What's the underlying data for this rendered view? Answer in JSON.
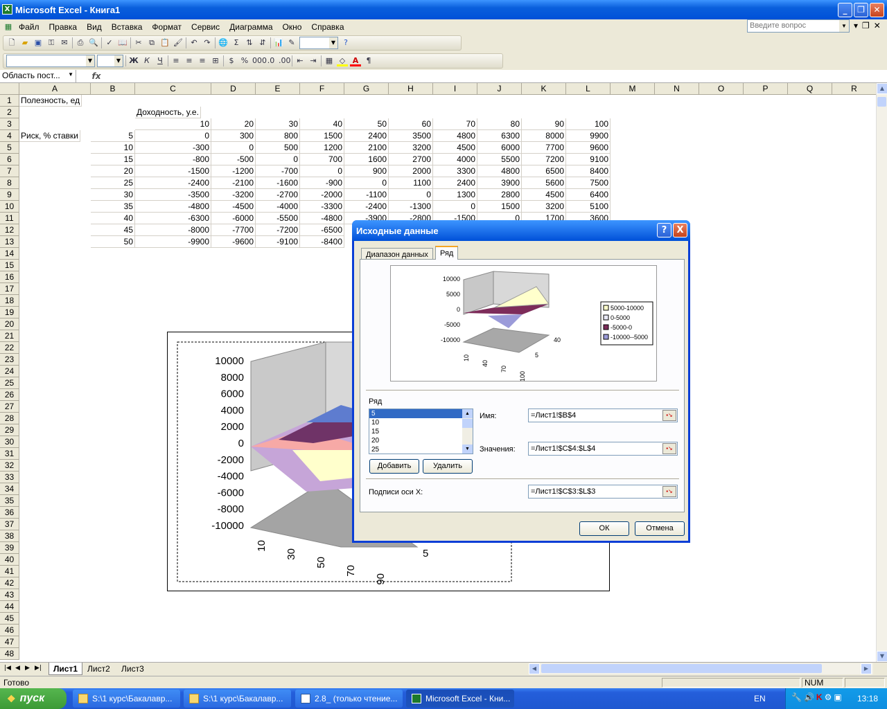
{
  "window": {
    "title": "Microsoft Excel - Книга1",
    "app_icon": "X"
  },
  "menu": [
    "Файл",
    "Правка",
    "Вид",
    "Вставка",
    "Формат",
    "Сервис",
    "Диаграмма",
    "Окно",
    "Справка"
  ],
  "help_box": {
    "placeholder": "Введите вопрос"
  },
  "formula_bar": {
    "name_box": "Область пост...",
    "fx": "fx",
    "formula": ""
  },
  "columns": [
    "A",
    "B",
    "C",
    "D",
    "E",
    "F",
    "G",
    "H",
    "I",
    "J",
    "K",
    "L",
    "M",
    "N",
    "O",
    "P",
    "Q",
    "R"
  ],
  "rows": [
    "1",
    "2",
    "3",
    "4",
    "5",
    "6",
    "7",
    "8",
    "9",
    "10",
    "11",
    "12",
    "13",
    "14",
    "15",
    "16",
    "17",
    "18",
    "19",
    "20",
    "21",
    "22",
    "23",
    "24",
    "25",
    "26",
    "27",
    "28",
    "29",
    "30",
    "31",
    "32",
    "33",
    "34",
    "35",
    "36",
    "37",
    "38",
    "39",
    "40",
    "41",
    "42",
    "43",
    "44",
    "45",
    "46",
    "47",
    "48"
  ],
  "cells": {
    "a1": "Полезность, ед",
    "c2": "Доходность, у.е.",
    "a4": "Риск, % ставки",
    "header_row": [
      "10",
      "20",
      "30",
      "40",
      "50",
      "60",
      "70",
      "80",
      "90",
      "100"
    ],
    "b_values": [
      "5",
      "10",
      "15",
      "20",
      "25",
      "30",
      "35",
      "40",
      "45",
      "50"
    ],
    "r4": [
      "0",
      "300",
      "800",
      "1500",
      "2400",
      "3500",
      "4800",
      "6300",
      "8000",
      "9900"
    ],
    "r5": [
      "-300",
      "0",
      "500",
      "1200",
      "2100",
      "3200",
      "4500",
      "6000",
      "7700",
      "9600"
    ],
    "r6": [
      "-800",
      "-500",
      "0",
      "700",
      "1600",
      "2700",
      "4000",
      "5500",
      "7200",
      "9100"
    ],
    "r7": [
      "-1500",
      "-1200",
      "-700",
      "0",
      "900",
      "2000",
      "3300",
      "4800",
      "6500",
      "8400"
    ],
    "r8": [
      "-2400",
      "-2100",
      "-1600",
      "-900",
      "0",
      "1100",
      "2400",
      "3900",
      "5600",
      "7500"
    ],
    "r9": [
      "-3500",
      "-3200",
      "-2700",
      "-2000",
      "-1100",
      "0",
      "1300",
      "2800",
      "4500",
      "6400"
    ],
    "r10": [
      "-4800",
      "-4500",
      "-4000",
      "-3300",
      "-2400",
      "-1300",
      "0",
      "1500",
      "3200",
      "5100"
    ],
    "r11": [
      "-6300",
      "-6000",
      "-5500",
      "-4800",
      "-3900",
      "-2800",
      "-1500",
      "0",
      "1700",
      "3600"
    ],
    "r12": [
      "-8000",
      "-7700",
      "-7200",
      "-6500"
    ],
    "r13": [
      "-9900",
      "-9600",
      "-9100",
      "-8400"
    ]
  },
  "chart_main": {
    "y_ticks": [
      "10000",
      "8000",
      "6000",
      "4000",
      "2000",
      "0",
      "-2000",
      "-4000",
      "-6000",
      "-8000",
      "-10000"
    ],
    "x_ticks": [
      "10",
      "30",
      "50",
      "70",
      "90"
    ],
    "depth_tick": "5"
  },
  "dialog": {
    "title": "Исходные данные",
    "help": "?",
    "close": "X",
    "tabs": [
      "Диапазон данных",
      "Ряд"
    ],
    "preview": {
      "y_ticks": [
        "10000",
        "5000",
        "0",
        "-5000",
        "-10000"
      ],
      "x_ticks": [
        "10",
        "40",
        "70",
        "100"
      ],
      "depth_ticks": [
        "5",
        "40"
      ],
      "legend": [
        "5000-10000",
        "0-5000",
        "-5000-0",
        "-10000--5000"
      ],
      "legend_colors": [
        "#ffffcc",
        "#e9e9f6",
        "#7d2c5a",
        "#9b9bd9"
      ]
    },
    "series_label": "Ряд",
    "series_list": [
      "5",
      "10",
      "15",
      "20",
      "25"
    ],
    "selected_series": "5",
    "add_btn": "Добавить",
    "remove_btn": "Удалить",
    "name_label": "Имя:",
    "name_value": "=Лист1!$B$4",
    "values_label": "Значения:",
    "values_value": "=Лист1!$C$4:$L$4",
    "xaxis_label": "Подписи оси X:",
    "xaxis_value": "=Лист1!$C$3:$L$3",
    "ok": "ОК",
    "cancel": "Отмена"
  },
  "sheet_tabs": [
    "Лист1",
    "Лист2",
    "Лист3"
  ],
  "status": {
    "left": "Готово",
    "num": "NUM"
  },
  "taskbar": {
    "start": "пуск",
    "tasks": [
      "S:\\1 курс\\Бакалавр...",
      "S:\\1 курс\\Бакалавр...",
      "2.8_ (только чтение...",
      "Microsoft Excel - Кни..."
    ],
    "lang": "EN",
    "clock": "13:18"
  }
}
